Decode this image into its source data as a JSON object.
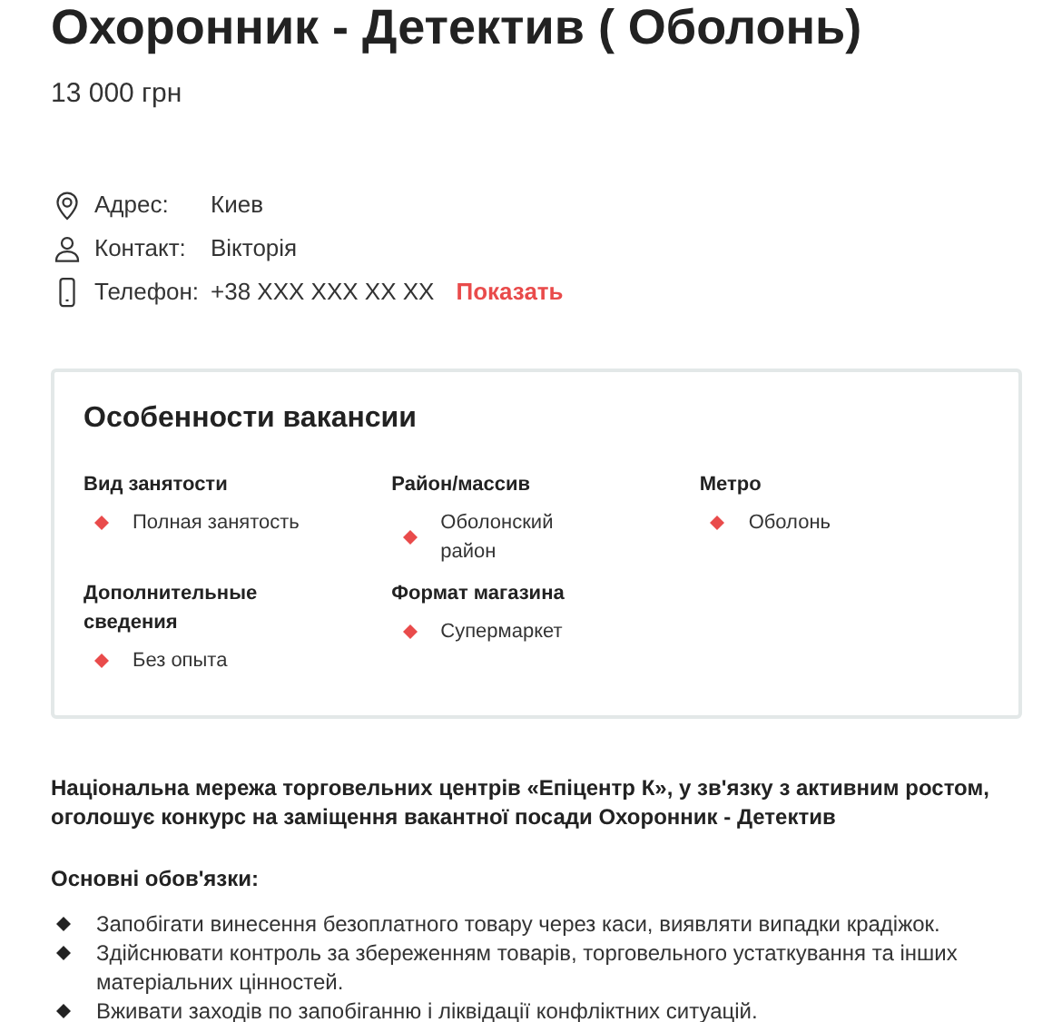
{
  "title": "Охоронник - Детектив ( Оболонь)",
  "price": "13 000 грн",
  "contacts": [
    {
      "kind": "address",
      "label": "Адрес:",
      "value": "Киев"
    },
    {
      "kind": "person",
      "label": "Контакт:",
      "value": "Вікторія"
    },
    {
      "kind": "phone",
      "label": "Телефон:",
      "value": "+38 XXX XXX XX XX",
      "action": "Показать"
    }
  ],
  "features": {
    "title": "Особенности вакансии",
    "groups": [
      {
        "label": "Вид занятости",
        "values": [
          "Полная занятость"
        ]
      },
      {
        "label": "Район/массив",
        "values": [
          "Оболонский район"
        ]
      },
      {
        "label": "Метро",
        "values": [
          "Оболонь"
        ]
      },
      {
        "label": "Дополнительные сведения",
        "values": [
          "Без опыта"
        ]
      },
      {
        "label": "Формат магазина",
        "values": [
          "Супермаркет"
        ]
      }
    ]
  },
  "intro": "Національна мережа торговельних центрів «Епіцентр К», у зв'язку з активним ростом, оголошує конкурс на заміщення вакантної посади Охоронник - Детектив",
  "duties": {
    "title": "Основні обов'язки:",
    "items": [
      "Запобігати винесення безоплатного товару через каси, виявляти випадки крадіжок.",
      "Здійснювати контроль за збереженням товарів, торговельного устаткування та інших матеріальних цінностей.",
      "Вживати заходів по запобіганню і ліквідації конфліктних ситуацій."
    ]
  }
}
